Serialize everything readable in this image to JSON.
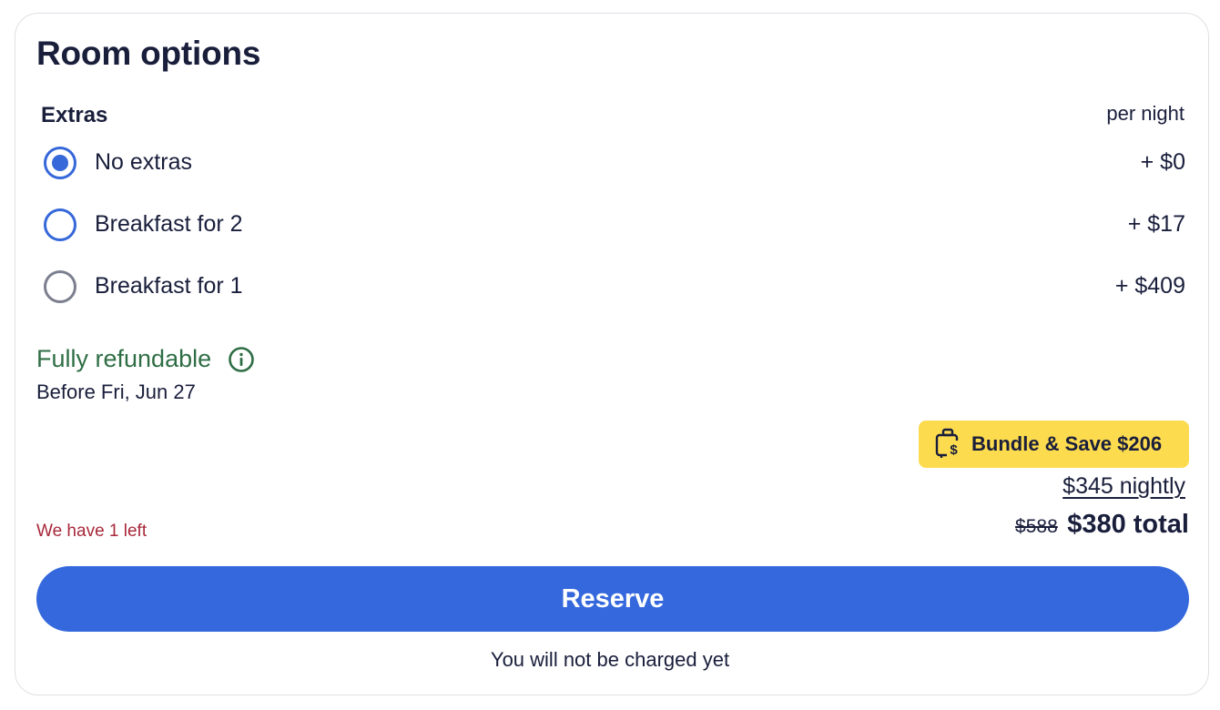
{
  "card": {
    "title": "Room options"
  },
  "extras": {
    "label": "Extras",
    "price_unit": "per night",
    "selected": "No extras",
    "options": [
      {
        "label": "No extras",
        "price": "+ $0",
        "checked": true
      },
      {
        "label": "Breakfast for 2",
        "price": "+ $17",
        "checked": false
      },
      {
        "label": "Breakfast for 1",
        "price": "+ $409",
        "checked": false
      }
    ]
  },
  "refund": {
    "status": "Fully refundable",
    "deadline": "Before Fri, Jun 27",
    "icon": "info-icon"
  },
  "bundle": {
    "label": "Bundle & Save $206",
    "icon": "bag-dollar-icon"
  },
  "pricing": {
    "nightly": "$345 nightly",
    "original_total": "$588",
    "total": "$380 total"
  },
  "availability": {
    "rooms_left": "We have 1 left"
  },
  "actions": {
    "reserve_label": "Reserve",
    "charge_note": "You will not be charged yet"
  },
  "colors": {
    "primary": "#3468dc",
    "refund_green": "#2f6e45",
    "alert_red": "#a8283a",
    "badge_yellow": "#fddb4f",
    "text": "#191e3b"
  }
}
